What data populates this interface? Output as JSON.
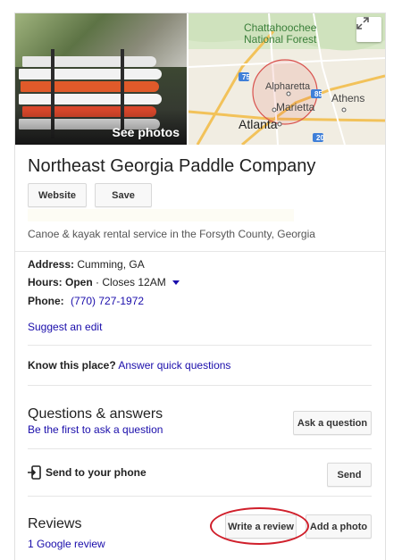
{
  "photo": {
    "see_photos_label": "See photos"
  },
  "map": {
    "labels": {
      "forest_line1": "Chattahoochee",
      "forest_line2": "National Forest",
      "alpharetta": "Alpharetta",
      "marietta": "Marietta",
      "athens": "Athens",
      "atlanta": "Atlanta",
      "hwy_75": "75",
      "hwy_85": "85",
      "hwy_20": "20"
    }
  },
  "business": {
    "name": "Northeast Georgia Paddle Company",
    "description": "Canoe & kayak rental service in the Forsyth County, Georgia"
  },
  "actions": {
    "website_label": "Website",
    "save_label": "Save"
  },
  "details": {
    "address_label": "Address:",
    "address_value": "Cumming, GA",
    "hours_label": "Hours:",
    "hours_status": "Open",
    "hours_separator": " · ",
    "hours_close": "Closes 12AM",
    "phone_label": "Phone:",
    "phone_value": "(770) 727-1972"
  },
  "suggest_edit": "Suggest an edit",
  "know_place": {
    "label": "Know this place?",
    "link": "Answer quick questions"
  },
  "qa": {
    "title": "Questions & answers",
    "subtitle": "Be the first to ask a question",
    "button": "Ask a question"
  },
  "send_to_phone": {
    "label": "Send to your phone",
    "button": "Send"
  },
  "reviews": {
    "title": "Reviews",
    "count": "1 Google review",
    "write_button": "Write a review",
    "photo_button": "Add a photo"
  },
  "colors": {
    "link": "#1a0dab",
    "highlight_ellipse": "#d01f2b"
  }
}
